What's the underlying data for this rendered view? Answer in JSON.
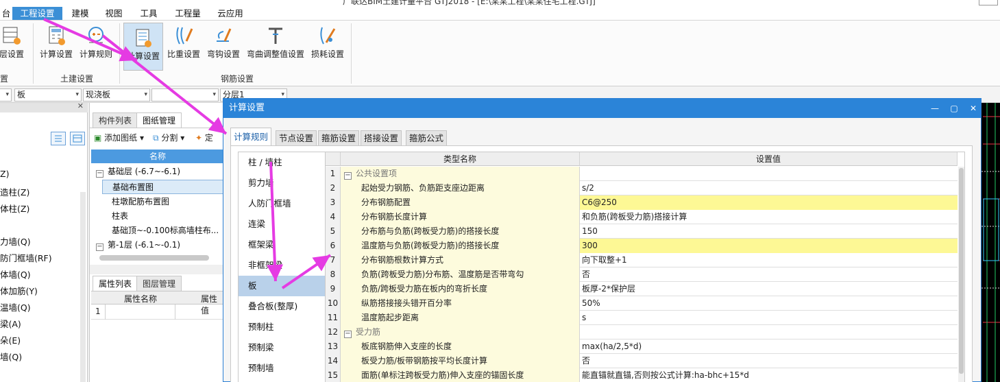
{
  "window": {
    "title_fragment": "广联达BIM土建计量平台 GTJ2018 - [E:\\某某工程\\某某住宅工程.GTJ]"
  },
  "menu": [
    "台",
    "工程设置",
    "建模",
    "视图",
    "工具",
    "工程量",
    "云应用"
  ],
  "ribbon": {
    "buttons": [
      {
        "label": "层设置",
        "icon": "floor-settings-icon"
      },
      {
        "label": "计算设置",
        "icon": "calc-settings-icon"
      },
      {
        "label": "计算规则",
        "icon": "calc-rules-icon"
      },
      {
        "label": "计算设置",
        "icon": "rebar-calc-settings-icon"
      },
      {
        "label": "比重设置",
        "icon": "density-settings-icon"
      },
      {
        "label": "弯钩设置",
        "icon": "hook-settings-icon"
      },
      {
        "label": "弯曲调整值设置",
        "icon": "bend-adjust-icon"
      },
      {
        "label": "损耗设置",
        "icon": "loss-settings-icon"
      }
    ],
    "groups": [
      "置",
      "土建设置",
      "钢筋设置"
    ]
  },
  "selects": [
    "板",
    "现浇板",
    "",
    "分层1"
  ],
  "leftnav": [
    "Z)",
    "造柱(Z)",
    "体柱(Z)",
    "力墙(Q)",
    "防门框墙(RF)",
    "体墙(Q)",
    "体加筋(Y)",
    "温墙(Q)",
    "梁(A)",
    "朵(E)",
    "墙(Q)"
  ],
  "midpanel": {
    "tabs": [
      "构件列表",
      "图纸管理"
    ],
    "toolbar": {
      "add": "添加图纸",
      "split": "分割",
      "locate": "定"
    },
    "header": "名称",
    "rows": [
      {
        "label": "基础层 (-6.7~-6.1)",
        "group": true
      },
      {
        "label": "基础布置图",
        "group": false
      },
      {
        "label": "柱墩配筋布置图",
        "group": false
      },
      {
        "label": "柱表",
        "group": false
      },
      {
        "label": "基础顶~-0.100标高墙柱布...",
        "group": false
      },
      {
        "label": "第-1层 (-6.1~-0.1)",
        "group": true
      }
    ],
    "prop_tabs": [
      "属性列表",
      "图层管理"
    ],
    "prop_headers": [
      "属性名称",
      "属性值"
    ],
    "prop_row": "1"
  },
  "dialog": {
    "title": "计算设置",
    "tabs": [
      "计算规则",
      "节点设置",
      "箍筋设置",
      "搭接设置",
      "箍筋公式"
    ],
    "categories": [
      "柱 / 墙柱",
      "剪力墙",
      "人防门框墙",
      "连梁",
      "框架梁",
      "非框架梁",
      "板",
      "叠合板(整厚)",
      "预制柱",
      "预制梁",
      "预制墙"
    ],
    "active_category": 6,
    "columns": [
      "类型名称",
      "设置值"
    ],
    "rows": [
      {
        "n": "1",
        "name": "公共设置项",
        "value": "",
        "group": true
      },
      {
        "n": "2",
        "name": "起始受力钢筋、负筋距支座边距离",
        "value": "s/2"
      },
      {
        "n": "3",
        "name": "分布钢筋配置",
        "value": "C6@250",
        "highlight": true
      },
      {
        "n": "4",
        "name": "分布钢筋长度计算",
        "value": "和负筋(跨板受力筋)搭接计算"
      },
      {
        "n": "5",
        "name": "分布筋与负筋(跨板受力筋)的搭接长度",
        "value": "150"
      },
      {
        "n": "6",
        "name": "温度筋与负筋(跨板受力筋)的搭接长度",
        "value": "300",
        "highlight": true
      },
      {
        "n": "7",
        "name": "分布钢筋根数计算方式",
        "value": "向下取整+1"
      },
      {
        "n": "8",
        "name": "负筋(跨板受力筋)分布筋、温度筋是否带弯勾",
        "value": "否"
      },
      {
        "n": "9",
        "name": "负筋/跨板受力筋在板内的弯折长度",
        "value": "板厚-2*保护层"
      },
      {
        "n": "10",
        "name": "纵筋搭接接头错开百分率",
        "value": "50%"
      },
      {
        "n": "11",
        "name": "温度筋起步距离",
        "value": "s"
      },
      {
        "n": "12",
        "name": "受力筋",
        "value": "",
        "group": true
      },
      {
        "n": "13",
        "name": "板底钢筋伸入支座的长度",
        "value": "max(ha/2,5*d)"
      },
      {
        "n": "14",
        "name": "板受力筋/板带钢筋按平均长度计算",
        "value": "否"
      },
      {
        "n": "15",
        "name": "面筋(单标注跨板受力筋)伸入支座的锚固长度",
        "value": "能直锚就直锚,否则按公式计算:ha-bhc+15*d"
      }
    ]
  },
  "colors": {
    "accent": "#2b84d8",
    "menu_active": "#3b8fd6",
    "highlight": "#fdf895",
    "name_bg": "#fdfbdd",
    "arrow": "#e53be3"
  }
}
